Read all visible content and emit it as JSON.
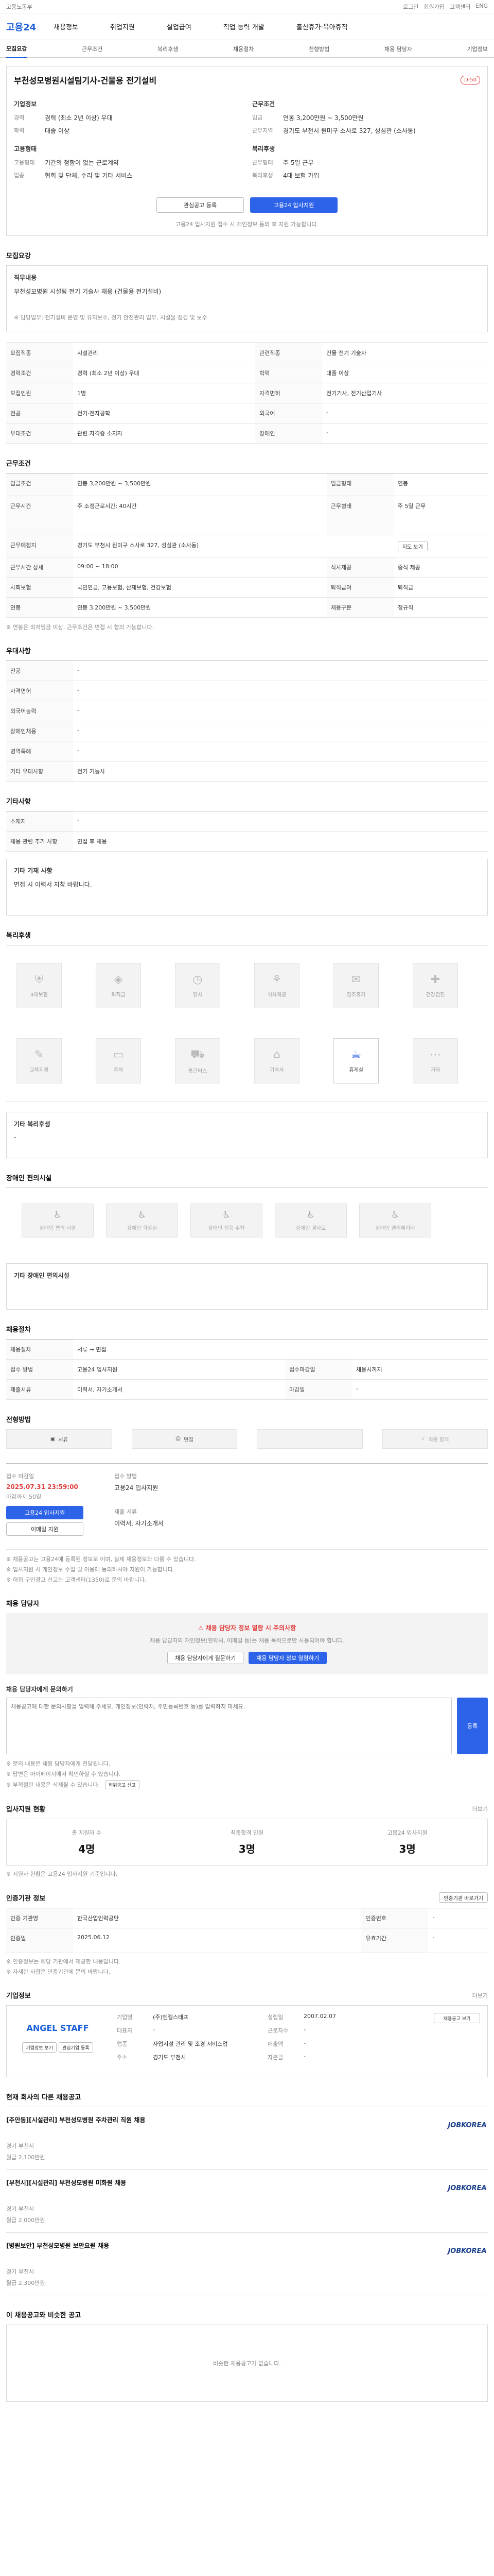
{
  "topbar": {
    "left": "고용노동부",
    "links": [
      "로그인",
      "회원가입",
      "고객센터",
      "ENG"
    ]
  },
  "gnb": {
    "logo": "고용24",
    "menu": [
      "채용정보",
      "취업지원",
      "실업급여",
      "직업 능력 개발",
      "출산휴가·육아휴직"
    ]
  },
  "tabs": [
    "모집요강",
    "근무조건",
    "복리후생",
    "채용절차",
    "전형방법",
    "채용 담당자",
    "기업정보"
  ],
  "job": {
    "title": "부천성모병원시설팀기사-건물용 전기설비",
    "badge": "D-50",
    "company_label": "기업정보",
    "company_value": "",
    "industry_label": "업종",
    "industry_value": "협회 및 단체, 수리 및 기타 서비스",
    "size_label": "기업규모",
    "size_value": "",
    "cond_label": "근무조건",
    "wage_label": "임금",
    "wage_value": "연봉 3,200만원 ~ 3,500만원",
    "place_label": "근무지역",
    "place_value": "경기도 부천시 원미구 소사로 327, 성심관 (소사동)",
    "career_label": "경력",
    "career_value": "경력 (최소 2년 이상) 우대",
    "edu_label": "학력",
    "edu_value": "대졸 이상",
    "type_label": "고용형태",
    "type_value": "기간의 정함이 없는 근로계약",
    "time_label": "근무형태",
    "time_value": "주 5일 근무",
    "welfare_label": "복리후생",
    "welfare_value": "4대 보험 가입",
    "save_btn": "관심공고 등록",
    "apply_btn": "고용24 입사지원",
    "notice": "고용24 입사지원 접수 시 개인정보 동의 후 지원 가능합니다."
  },
  "recruit": {
    "title": "모집요강",
    "duty_label": "직무내용",
    "duty_text": "부천성모병원 시설팀 전기 기술사 채용 (건물용 전기설비)",
    "duty_detail": "※ 담당업무: 전기설비 운영 및 유지보수, 전기 안전관리 업무, 시설물 점검 및 보수",
    "rows": [
      [
        "모집직종",
        "시설관리",
        "관련직종",
        "건물 전기 기술자"
      ],
      [
        "경력조건",
        "경력 (최소 2년 이상) 우대",
        "학력",
        "대졸 이상"
      ],
      [
        "모집인원",
        "1명",
        "자격면허",
        "전기기사, 전기산업기사"
      ],
      [
        "전공",
        "전기·전자공학",
        "외국어",
        "-"
      ],
      [
        "우대조건",
        "관련 자격증 소지자",
        "장애인",
        "-"
      ]
    ]
  },
  "condition": {
    "title": "근무조건",
    "rows": [
      [
        "임금조건",
        "연봉 3,200만원 ~ 3,500만원",
        "임금형태",
        "연봉"
      ],
      [
        "근무시간",
        "주 소정근로시간: 40시간",
        "근무형태",
        "주 5일 근무"
      ],
      [
        "근무예정지",
        "경기도 부천시 원미구 소사로 327, 성심관 (소사동)",
        "",
        ""
      ],
      [
        "근무시간 상세",
        "09:00 ~ 18:00",
        "식사제공",
        "중식 제공"
      ],
      [
        "사회보험",
        "국민연금, 고용보험, 산재보험, 건강보험",
        "퇴직급여",
        "퇴직금"
      ],
      [
        "연봉",
        "연봉 3,200만원 ~ 3,500만원",
        "채용구분",
        "정규직"
      ]
    ],
    "note": "※ 연봉은 최저임금 이상, 근무조건은 면접 시 협의 가능합니다."
  },
  "etc": {
    "title": "우대사항",
    "rows": [
      [
        "전공",
        "-"
      ],
      [
        "자격면허",
        "-"
      ],
      [
        "외국어능력",
        "-"
      ],
      [
        "장애인채용",
        "-"
      ],
      [
        "병역특례",
        "-"
      ],
      [
        "기타 우대사항",
        "전기 기능사"
      ]
    ]
  },
  "other": {
    "title": "기타사항",
    "rows": [
      [
        "소재지",
        "-"
      ],
      [
        "채용 관련 추가 사항",
        "면접 후 채용"
      ],
      [
        "기타 기재 사항",
        "면접 시 이력서 지참 바랍니다."
      ]
    ]
  },
  "welfare": {
    "title": "복리후생",
    "items": [
      "4대보험",
      "퇴직금",
      "연차",
      "식사제공",
      "경조휴가",
      "건강검진",
      "교육지원",
      "주차",
      "통근버스",
      "기숙사",
      "휴게실",
      "기타"
    ],
    "on_index": 10,
    "detail_label": "기타 복리후생",
    "detail_value": "-"
  },
  "disability": {
    "title": "장애인 편의시설",
    "items": [
      "장애인 편의 시설",
      "장애인 화장실",
      "장애인 전용 주차",
      "장애인 경사로",
      "장애인 엘리베이터"
    ]
  },
  "process": {
    "title": "채용절차",
    "rows": [
      [
        "채용절차",
        "서류 → 면접"
      ],
      [
        "접수 방법",
        "고용24 입사지원"
      ],
      [
        "접수마감일",
        "채용시까지"
      ],
      [
        "제출서류",
        "이력서, 자기소개서"
      ],
      [
        "마감일",
        "-"
      ]
    ]
  },
  "method": {
    "title": "전형방법",
    "steps": [
      "서류",
      "면접",
      "",
      "최종 합격"
    ]
  },
  "apply": {
    "deadline_label": "접수 마감일",
    "deadline": "2025.07.31 23:59:00",
    "remain": "마감까지 50일",
    "method_label": "접수 방법",
    "method_text": "고용24 입사지원",
    "apply_btn": "고용24 입사지원",
    "email_btn": "이메일 지원",
    "docs_label": "제출 서류",
    "docs_text": "이력서, 자기소개서",
    "notice_lines": [
      "※ 채용공고는 고용24에 등록된 정보로 이며, 실제 채용정보와 다를 수 있습니다.",
      "※ 입사지원 시 개인정보 수집 및 이용에 동의하셔야 지원이 가능합니다.",
      "※ 허위 구인광고 신고는 고객센터(1350)로 문의 바랍니다."
    ]
  },
  "contact": {
    "title": "채용 담당자",
    "alert_title": "채용 담당자 정보 열람 시 주의사항",
    "alert_text": "채용 담당자의 개인정보(연락처, 이메일 등)는 채용 목적으로만 사용되어야 합니다.",
    "alert_btn1": "채용 담당자에게 질문하기",
    "alert_btn2": "채용 담당자 정보 열람하기",
    "inquiry_label": "채용 담당자에게 문의하기",
    "inquiry_placeholder": "채용공고에 대한 문의사항을 입력해 주세요. 개인정보(연락처, 주민등록번호 등)를 입력하지 마세요.",
    "inquiry_btn": "등록",
    "inquiry_notes": [
      "※ 문의 내용은 채용 담당자에게 전달됩니다.",
      "※ 답변은 마이페이지에서 확인하실 수 있습니다.",
      "※ 부적절한 내용은 삭제될 수 있습니다."
    ],
    "report_btn": "허위공고 신고"
  },
  "stats": {
    "title": "입사지원 현황",
    "more": "더보기",
    "items": [
      [
        "총 지원자 수",
        "4명"
      ],
      [
        "최종합격 인원",
        "3명"
      ],
      [
        "고용24 입사지원",
        "3명"
      ]
    ],
    "note": "※ 지원자 현황은 고용24 입사지원 기준입니다."
  },
  "info": {
    "title": "인증기관 정보",
    "more": "인증기관 바로가기",
    "rows": [
      [
        "인증 기관명",
        "한국산업인력공단",
        "인증번호",
        "-"
      ],
      [
        "인증일",
        "2025.06.12",
        "유효기간",
        "-"
      ]
    ],
    "notes": [
      "※ 인증정보는 해당 기관에서 제공한 내용입니다.",
      "※ 자세한 사항은 인증기관에 문의 바랍니다."
    ]
  },
  "company": {
    "title": "기업정보",
    "more": "더보기",
    "logo": "ANGEL STAFF",
    "name_label": "기업명",
    "name": "(주)엔젤스태프",
    "ceo_label": "대표자",
    "ceo": "-",
    "type_label": "업종",
    "type": "사업시설 관리 및 조경 서비스업",
    "addr_label": "주소",
    "addr": "경기도 부천시",
    "found_label": "설립일",
    "found": "2007.02.07",
    "emp_label": "근로자수",
    "emp": "-",
    "sales_label": "매출액",
    "sales": "-",
    "cap_label": "자본금",
    "cap": "-",
    "btn1": "기업정보 보기",
    "btn2": "관심기업 등록",
    "btn3": "채용공고 보기"
  },
  "others": {
    "title": "현재 회사의 다른 채용공고",
    "jobs": [
      {
        "title": "[주안동][시설관리] 부천성모병원 주차관리 직원 채용",
        "loc": "경기 부천시",
        "wage": "월급 2,100만원",
        "badge": "JOBKOREA"
      },
      {
        "title": "[부천시][시설관리] 부천성모병원 미화원 채용",
        "loc": "경기 부천시",
        "wage": "월급 2,000만원",
        "badge": "JOBKOREA"
      },
      {
        "title": "[병원보안] 부천성모병원 보안요원 채용",
        "loc": "경기 부천시",
        "wage": "월급 2,300만원",
        "badge": "JOBKOREA"
      }
    ]
  },
  "footer_title": "이 채용공고와 비슷한 공고",
  "footer_text": "비슷한 채용공고가 없습니다.",
  "colors": {
    "accent": "#2d63e8",
    "alert": "#e03b3b"
  }
}
